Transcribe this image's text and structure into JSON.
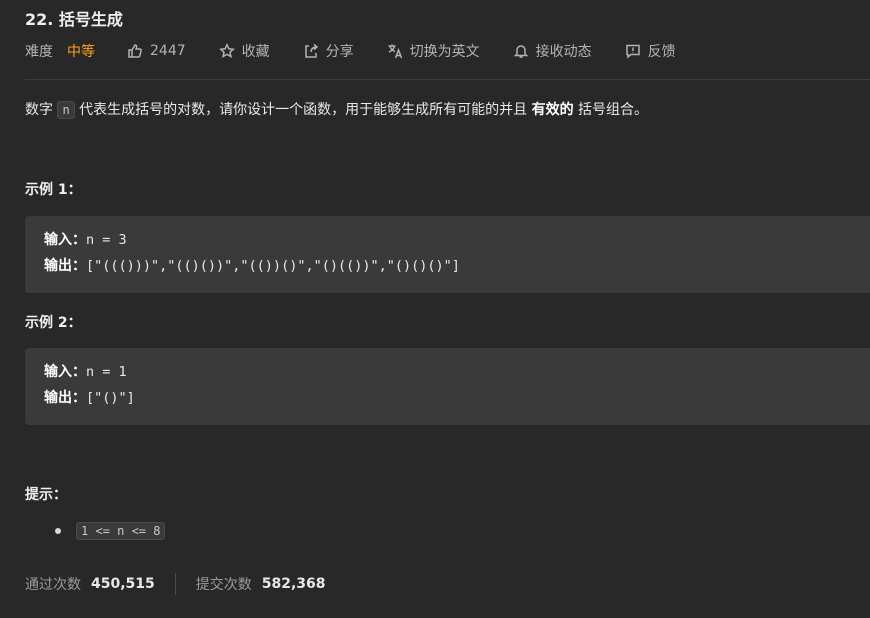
{
  "problem": {
    "title": "22. 括号生成",
    "difficulty_label": "难度",
    "difficulty": "中等",
    "difficulty_color": "#ffa116",
    "likes": "2447",
    "favorite_label": "收藏",
    "share_label": "分享",
    "translate_label": "切换为英文",
    "subscribe_label": "接收动态",
    "feedback_label": "反馈"
  },
  "icons": {
    "like": "thumbs-up-icon",
    "favorite": "star-icon",
    "share": "share-icon",
    "translate": "translate-icon",
    "subscribe": "bell-icon",
    "feedback": "feedback-icon"
  },
  "description": {
    "part1": "数字",
    "code_n": "n",
    "part2": "代表生成括号的对数，请你设计一个函数，用于能够生成所有可能的并且",
    "bold": "有效的",
    "part3": "括号组合。"
  },
  "examples": [
    {
      "title": "示例 1：",
      "input_label": "输入：",
      "input_value": "n = 3",
      "output_label": "输出：",
      "output_value": "[\"((()))\",\"(()())\",\"(())()\",\"()(())\",\"()()()\"]"
    },
    {
      "title": "示例 2：",
      "input_label": "输入：",
      "input_value": "n = 1",
      "output_label": "输出：",
      "output_value": "[\"()\"]"
    }
  ],
  "hints": {
    "title": "提示：",
    "constraint": "1 <= n <= 8"
  },
  "stats": {
    "accepted_label": "通过次数",
    "accepted_value": "450,515",
    "submissions_label": "提交次数",
    "submissions_value": "582,368"
  }
}
